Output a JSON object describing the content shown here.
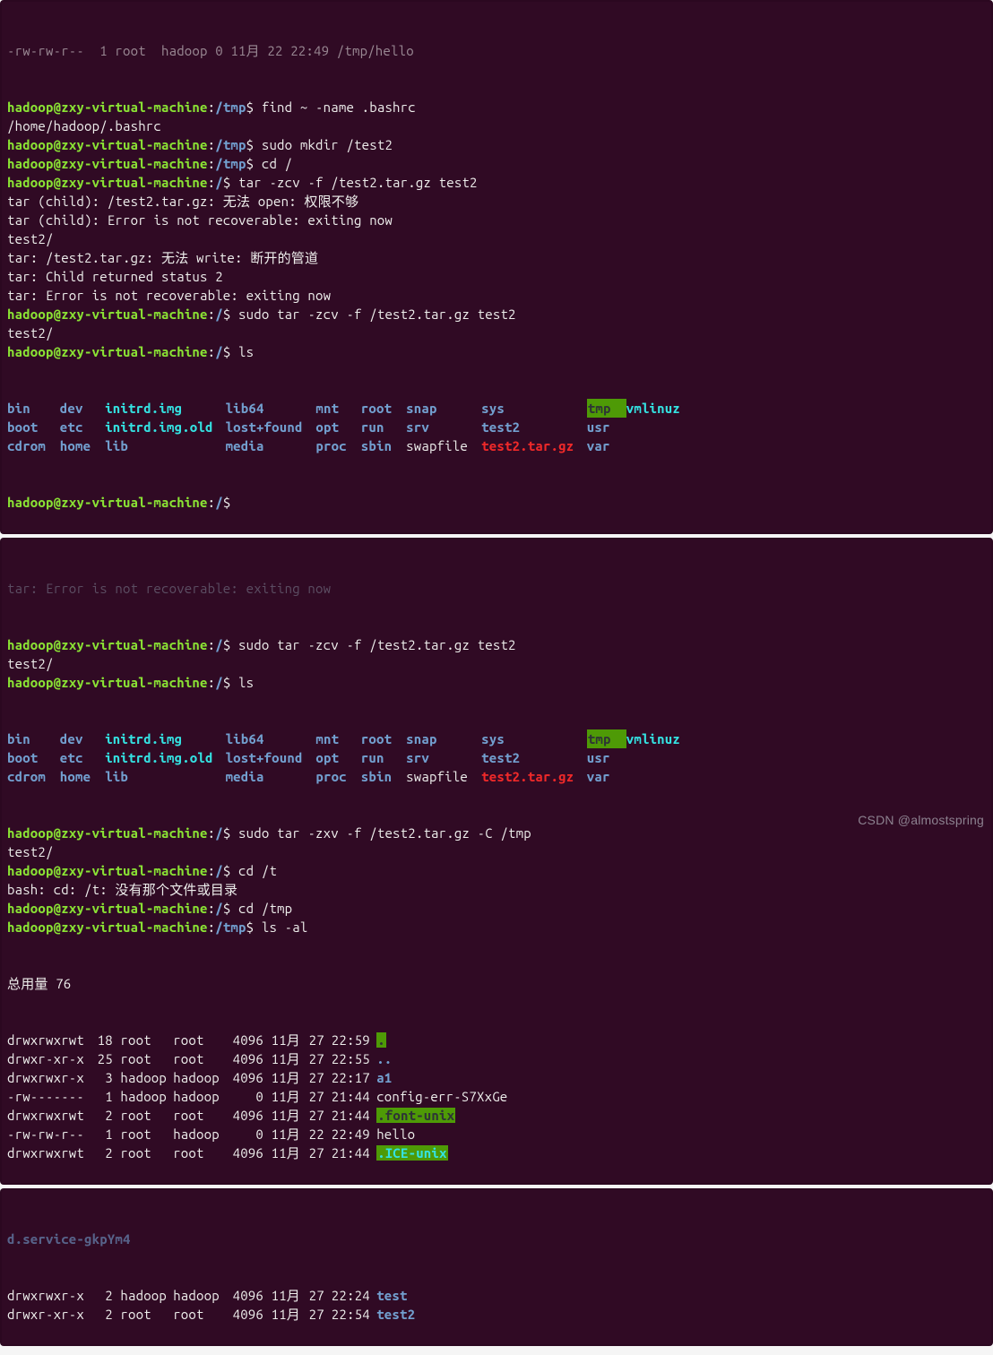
{
  "colors": {
    "bg": "#300a24",
    "fg": "#eeeeec",
    "user": "#8ae234",
    "path": "#729fcf",
    "cyan": "#34e2e2",
    "red": "#ef2929",
    "highlight_bg": "#4e9a06"
  },
  "watermark": "CSDN @almostspring",
  "pane1": {
    "residual_top": "-rw-rw-r--  1 root  hadoop 0 11月 22 22:49 /tmp/hello",
    "prompts": [
      {
        "user": "hadoop",
        "host": "zxy-virtual-machine",
        "cwd": "/tmp",
        "dollar": "$",
        "cmd": "find ~ -name .bashrc"
      },
      {
        "output": "/home/hadoop/.bashrc"
      },
      {
        "user": "hadoop",
        "host": "zxy-virtual-machine",
        "cwd": "/tmp",
        "dollar": "$",
        "cmd": "sudo mkdir /test2"
      },
      {
        "user": "hadoop",
        "host": "zxy-virtual-machine",
        "cwd": "/tmp",
        "dollar": "$",
        "cmd": "cd /"
      },
      {
        "user": "hadoop",
        "host": "zxy-virtual-machine",
        "cwd": "/",
        "dollar": "$",
        "cmd": "tar -zcv -f /test2.tar.gz test2"
      },
      {
        "output": "tar (child): /test2.tar.gz: 无法 open: 权限不够"
      },
      {
        "output": "tar (child): Error is not recoverable: exiting now"
      },
      {
        "output": "test2/"
      },
      {
        "output": "tar: /test2.tar.gz: 无法 write: 断开的管道"
      },
      {
        "output": "tar: Child returned status 2"
      },
      {
        "output": "tar: Error is not recoverable: exiting now"
      },
      {
        "user": "hadoop",
        "host": "zxy-virtual-machine",
        "cwd": "/",
        "dollar": "$",
        "cmd": "sudo tar -zcv -f /test2.tar.gz test2"
      },
      {
        "output": "test2/"
      },
      {
        "user": "hadoop",
        "host": "zxy-virtual-machine",
        "cwd": "/",
        "dollar": "$",
        "cmd": "ls"
      }
    ],
    "ls": {
      "rows": [
        [
          {
            "t": "bin",
            "c": "dir"
          },
          {
            "t": "dev",
            "c": "dir"
          },
          {
            "t": "initrd.img",
            "c": "cyan"
          },
          {
            "t": "lib64",
            "c": "dir"
          },
          {
            "t": "mnt",
            "c": "dir"
          },
          {
            "t": "root",
            "c": "dir"
          },
          {
            "t": "snap",
            "c": "dir"
          },
          {
            "t": "sys",
            "c": "dir"
          },
          {
            "t": "tmp",
            "c": "hl"
          },
          {
            "t": "vmlinuz",
            "c": "cyan"
          }
        ],
        [
          {
            "t": "boot",
            "c": "dir"
          },
          {
            "t": "etc",
            "c": "dir"
          },
          {
            "t": "initrd.img.old",
            "c": "cyan"
          },
          {
            "t": "lost+found",
            "c": "dir"
          },
          {
            "t": "opt",
            "c": "dir"
          },
          {
            "t": "run",
            "c": "dir"
          },
          {
            "t": "srv",
            "c": "dir"
          },
          {
            "t": "test2",
            "c": "dir"
          },
          {
            "t": "usr",
            "c": "dir"
          },
          {
            "t": "",
            "c": ""
          }
        ],
        [
          {
            "t": "cdrom",
            "c": "dir"
          },
          {
            "t": "home",
            "c": "dir"
          },
          {
            "t": "lib",
            "c": "dir"
          },
          {
            "t": "media",
            "c": "dir"
          },
          {
            "t": "proc",
            "c": "dir"
          },
          {
            "t": "sbin",
            "c": "dir"
          },
          {
            "t": "swapfile",
            "c": "out"
          },
          {
            "t": "test2.tar.gz",
            "c": "red"
          },
          {
            "t": "var",
            "c": "dir"
          },
          {
            "t": "",
            "c": ""
          }
        ]
      ]
    },
    "tail_prompt": {
      "user": "hadoop",
      "host": "zxy-virtual-machine",
      "cwd": "/",
      "dollar": "$",
      "cmd": ""
    }
  },
  "pane2": {
    "cut_top": "tar: Error is not recoverable: exiting now",
    "prompts_a": [
      {
        "user": "hadoop",
        "host": "zxy-virtual-machine",
        "cwd": "/",
        "dollar": "$",
        "cmd": "sudo tar -zcv -f /test2.tar.gz test2"
      },
      {
        "output": "test2/"
      },
      {
        "user": "hadoop",
        "host": "zxy-virtual-machine",
        "cwd": "/",
        "dollar": "$",
        "cmd": "ls"
      }
    ],
    "ls": {
      "rows": [
        [
          {
            "t": "bin",
            "c": "dir"
          },
          {
            "t": "dev",
            "c": "dir"
          },
          {
            "t": "initrd.img",
            "c": "cyan"
          },
          {
            "t": "lib64",
            "c": "dir"
          },
          {
            "t": "mnt",
            "c": "dir"
          },
          {
            "t": "root",
            "c": "dir"
          },
          {
            "t": "snap",
            "c": "dir"
          },
          {
            "t": "sys",
            "c": "dir"
          },
          {
            "t": "tmp",
            "c": "hl"
          },
          {
            "t": "vmlinuz",
            "c": "cyan"
          }
        ],
        [
          {
            "t": "boot",
            "c": "dir"
          },
          {
            "t": "etc",
            "c": "dir"
          },
          {
            "t": "initrd.img.old",
            "c": "cyan"
          },
          {
            "t": "lost+found",
            "c": "dir"
          },
          {
            "t": "opt",
            "c": "dir"
          },
          {
            "t": "run",
            "c": "dir"
          },
          {
            "t": "srv",
            "c": "dir"
          },
          {
            "t": "test2",
            "c": "dir"
          },
          {
            "t": "usr",
            "c": "dir"
          },
          {
            "t": "",
            "c": ""
          }
        ],
        [
          {
            "t": "cdrom",
            "c": "dir"
          },
          {
            "t": "home",
            "c": "dir"
          },
          {
            "t": "lib",
            "c": "dir"
          },
          {
            "t": "media",
            "c": "dir"
          },
          {
            "t": "proc",
            "c": "dir"
          },
          {
            "t": "sbin",
            "c": "dir"
          },
          {
            "t": "swapfile",
            "c": "out"
          },
          {
            "t": "test2.tar.gz",
            "c": "red"
          },
          {
            "t": "var",
            "c": "dir"
          },
          {
            "t": "",
            "c": ""
          }
        ]
      ]
    },
    "prompts_b": [
      {
        "user": "hadoop",
        "host": "zxy-virtual-machine",
        "cwd": "/",
        "dollar": "$",
        "cmd": "sudo tar -zxv -f /test2.tar.gz -C /tmp"
      },
      {
        "output": "test2/"
      },
      {
        "user": "hadoop",
        "host": "zxy-virtual-machine",
        "cwd": "/",
        "dollar": "$",
        "cmd": "cd /t"
      },
      {
        "output": "bash: cd: /t: 没有那个文件或目录"
      },
      {
        "user": "hadoop",
        "host": "zxy-virtual-machine",
        "cwd": "/",
        "dollar": "$",
        "cmd": "cd /tmp"
      },
      {
        "user": "hadoop",
        "host": "zxy-virtual-machine",
        "cwd": "/tmp",
        "dollar": "$",
        "cmd": "ls -al"
      }
    ],
    "lsal_header": "总用量 76",
    "lsal": [
      {
        "perm": "drwxrwxrwt",
        "links": "18",
        "owner": "root",
        "group": "root",
        "size": "4096",
        "mon": "11月",
        "day": "27",
        "time": "22:59",
        "name": ".",
        "c": "hl"
      },
      {
        "perm": "drwxr-xr-x",
        "links": "25",
        "owner": "root",
        "group": "root",
        "size": "4096",
        "mon": "11月",
        "day": "27",
        "time": "22:55",
        "name": "..",
        "c": "dir"
      },
      {
        "perm": "drwxrwxr-x",
        "links": "3",
        "owner": "hadoop",
        "group": "hadoop",
        "size": "4096",
        "mon": "11月",
        "day": "27",
        "time": "22:17",
        "name": "a1",
        "c": "dir"
      },
      {
        "perm": "-rw-------",
        "links": "1",
        "owner": "hadoop",
        "group": "hadoop",
        "size": "0",
        "mon": "11月",
        "day": "27",
        "time": "21:44",
        "name": "config-err-S7XxGe",
        "c": "out"
      },
      {
        "perm": "drwxrwxrwt",
        "links": "2",
        "owner": "root",
        "group": "root",
        "size": "4096",
        "mon": "11月",
        "day": "27",
        "time": "21:44",
        "name": ".font-unix",
        "c": "hl"
      },
      {
        "perm": "-rw-rw-r--",
        "links": "1",
        "owner": "root",
        "group": "hadoop",
        "size": "0",
        "mon": "11月",
        "day": "22",
        "time": "22:49",
        "name": "hello",
        "c": "out"
      },
      {
        "perm": "drwxrwxrwt",
        "links": "2",
        "owner": "root",
        "group": "root",
        "size": "4096",
        "mon": "11月",
        "day": "27",
        "time": "21:44",
        "name": ".ICE-unix",
        "c": "hlcy"
      }
    ]
  },
  "pane3": {
    "cut_top": "d.service-gkpYm4",
    "lsal": [
      {
        "perm": "drwxrwxr-x",
        "links": "2",
        "owner": "hadoop",
        "group": "hadoop",
        "size": "4096",
        "mon": "11月",
        "day": "27",
        "time": "22:24",
        "name": "test",
        "c": "dir"
      },
      {
        "perm": "drwxr-xr-x",
        "links": "2",
        "owner": "root",
        "group": "root",
        "size": "4096",
        "mon": "11月",
        "day": "27",
        "time": "22:54",
        "name": "test2",
        "c": "dir"
      }
    ]
  }
}
